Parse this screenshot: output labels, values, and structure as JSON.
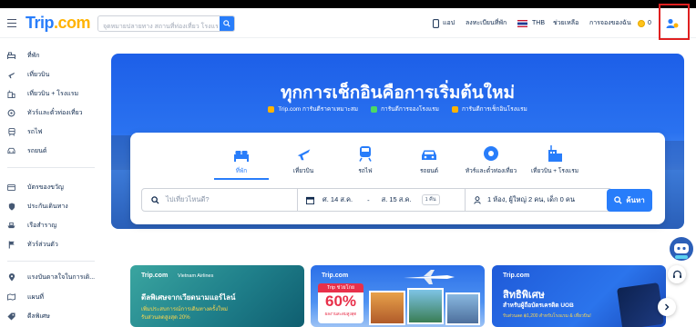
{
  "header": {
    "logo_text": "Trip",
    "logo_suffix": ".com",
    "search_placeholder": "จุดหมายปลายทาง สถานที่ท่องเที่ยว โรงแรม",
    "app_label": "แอป",
    "list_property_label": "ลงทะเบียนที่พัก",
    "currency": "THB",
    "help_label": "ช่วยเหลือ",
    "bookings_label": "การจองของฉัน",
    "coins": "0"
  },
  "sidebar": {
    "group1": [
      {
        "label": "ที่พัก",
        "icon": "bed-icon"
      },
      {
        "label": "เที่ยวบิน",
        "icon": "plane-icon"
      },
      {
        "label": "เที่ยวบิน + โรงแรม",
        "icon": "flight-hotel-icon"
      },
      {
        "label": "ทัวร์และตั๋วท่องเที่ยว",
        "icon": "ticket-icon"
      },
      {
        "label": "รถไฟ",
        "icon": "train-icon"
      },
      {
        "label": "รถยนต์",
        "icon": "car-icon"
      }
    ],
    "group2": [
      {
        "label": "บัตรของขวัญ",
        "icon": "gift-card-icon"
      },
      {
        "label": "ประกันเดินทาง",
        "icon": "shield-icon"
      },
      {
        "label": "เรือสำราญ",
        "icon": "ship-icon"
      },
      {
        "label": "ทัวร์ส่วนตัว",
        "icon": "flag-icon"
      }
    ],
    "group3": [
      {
        "label": "แรงบันดาลใจในการเดิ...",
        "icon": "map-pin-icon"
      },
      {
        "label": "แผนที่",
        "icon": "map-icon"
      },
      {
        "label": "ดีลพิเศษ",
        "icon": "deal-icon"
      }
    ]
  },
  "hero": {
    "title": "ทุกการเช็กอินคือการเริ่มต้นใหม่",
    "badges": [
      "Trip.com การันตีราคาเหมาะสม",
      "การันตีการจองโรงแรม",
      "การันตีการเช็กอินโรงแรม"
    ]
  },
  "search_card": {
    "tabs": [
      {
        "label": "ที่พัก",
        "icon": "bed-icon"
      },
      {
        "label": "เที่ยวบิน",
        "icon": "plane-icon"
      },
      {
        "label": "รถไฟ",
        "icon": "train-icon"
      },
      {
        "label": "รถยนต์",
        "icon": "car-icon"
      },
      {
        "label": "ทัวร์และตั๋วท่องเที่ยว",
        "icon": "ticket-icon"
      },
      {
        "label": "เที่ยวบิน + โรงแรม",
        "icon": "flight-hotel-icon"
      }
    ],
    "destination_placeholder": "ไปเที่ยวไหนดี?",
    "checkin": "ศ. 14 ส.ค.",
    "date_sep": "-",
    "checkout": "ส. 15 ส.ค.",
    "nights": "1 คืน",
    "guests": "1 ห้อง, ผู้ใหญ่ 2 คน, เด็ก 0 คน",
    "search_label": "ค้นหา"
  },
  "promos": [
    {
      "brand": "Trip.com",
      "partner": "Vietnam Airlines",
      "title": "ดีลพิเศษจากเวียดนามแอร์ไลน์",
      "sub": "เพิ่มประสบการณ์การเดินทางครั้งใหม่",
      "sub2": "รับส่วนลดสูงสุด 20%"
    },
    {
      "brand": "Trip.com",
      "tag": "Trip ช่วยโกย",
      "percent": "60%",
      "sub": "ผลงานสะสมสูงสุด"
    },
    {
      "brand": "Trip.com",
      "title": "สิทธิพิเศษ",
      "sub": "สำหรับผู้ถือบัตรเครดิต UOB",
      "sub2": "รับส่วนลด ฿1,200 สำหรับโรงแรม & เที่ยวบิน!"
    }
  ],
  "colors": {
    "brand": "#287dfa",
    "accent": "#ffb300",
    "highlight_box": "#e02020"
  }
}
